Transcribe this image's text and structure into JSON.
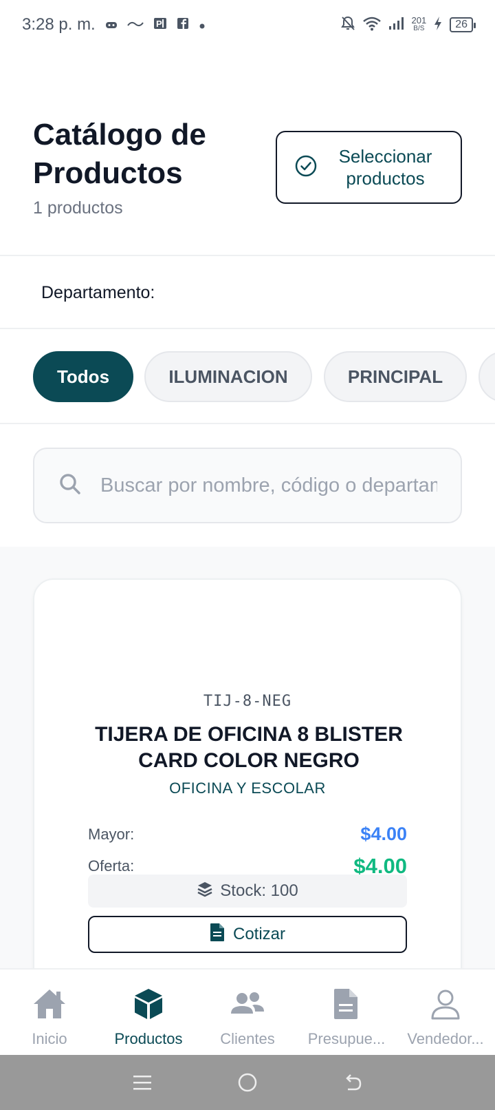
{
  "status_bar": {
    "time": "3:28 p. m.",
    "notif_icons": [
      "game-controller-icon",
      "hummy-icon",
      "parking-icon",
      "facebook-icon",
      "dot-icon"
    ],
    "net_speed_value": "201",
    "net_speed_unit": "B/S",
    "battery": "26"
  },
  "header": {
    "title": "Catálogo de Productos",
    "count": "1 productos",
    "select_button": "Seleccionar productos"
  },
  "filter": {
    "department_label": "Departamento:"
  },
  "chips": [
    {
      "label": "Todos",
      "active": true
    },
    {
      "label": "ILUMINACION",
      "active": false
    },
    {
      "label": "PRINCIPAL",
      "active": false
    }
  ],
  "search": {
    "placeholder": "Buscar por nombre, código o departamento"
  },
  "product": {
    "sku": "TIJ-8-NEG",
    "name": "TIJERA DE OFICINA 8 BLISTER CARD COLOR NEGRO",
    "department": "OFICINA Y ESCOLAR",
    "mayor_label": "Mayor:",
    "mayor_price": "$4.00",
    "oferta_label": "Oferta:",
    "oferta_price": "$4.00",
    "stock": "Stock: 100",
    "quote_button": "Cotizar"
  },
  "bottom_nav": [
    {
      "label": "Inicio",
      "icon": "home-icon",
      "active": false
    },
    {
      "label": "Productos",
      "icon": "box-icon",
      "active": true
    },
    {
      "label": "Clientes",
      "icon": "users-icon",
      "active": false
    },
    {
      "label": "Presupue...",
      "icon": "document-icon",
      "active": false
    },
    {
      "label": "Vendedor...",
      "icon": "user-icon",
      "active": false
    }
  ],
  "colors": {
    "primary": "#0b4a55",
    "price_blue": "#3b82f6",
    "price_green": "#10b981"
  }
}
